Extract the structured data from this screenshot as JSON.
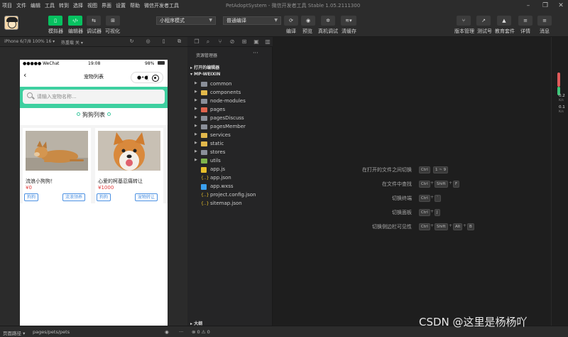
{
  "menu": [
    "项目",
    "文件",
    "编辑",
    "工具",
    "转到",
    "选择",
    "视图",
    "界面",
    "设置",
    "帮助",
    "微信开发者工具"
  ],
  "window_title": "PetAdoptSystem - 微信开发者工具 Stable 1.05.2111300",
  "toolbar": {
    "simulator": "模拟器",
    "editor": "编辑器",
    "debugger": "调试器",
    "visual": "可视化",
    "mode_select": "小程序模式",
    "compile_select": "普通编译",
    "compile": "编译",
    "preview": "预览",
    "real_debug": "真机调试",
    "clear_cache": "清缓存",
    "version": "版本管理",
    "test": "测试号",
    "edu": "教育套件",
    "details": "详情",
    "messages": "消息"
  },
  "simbar": {
    "device": "iPhone 6/7/8 100% 16 ▾",
    "hotreload": "热重载 关 ▾"
  },
  "phone": {
    "carrier": "●●●●● WeChat",
    "time": "19:08",
    "battery": "98%",
    "page_title": "宠物列表",
    "search_placeholder": "请输入宠物名称...",
    "section_title": "狗狗列表",
    "cards": [
      {
        "name": "流浪小狗狗！",
        "price": "¥0",
        "tags": [
          "狗狗",
          "流浪领养"
        ]
      },
      {
        "name": "心爱的柯基忍痛转让",
        "price": "¥1000",
        "tags": [
          "狗狗",
          "宠物转让"
        ]
      }
    ]
  },
  "explorer": {
    "header": "资源管理器",
    "open_editors": "打开的编辑器",
    "project": "MP-WEIXIN",
    "items": [
      "common",
      "components",
      "node-modules",
      "pages",
      "pagesDiscuss",
      "pagesMember",
      "services",
      "static",
      "stores",
      "utils",
      "app.js",
      "app.json",
      "app.wxss",
      "project.config.json",
      "sitemap.json"
    ],
    "outline": "大纲"
  },
  "shortcuts": [
    {
      "label": "在打开的文件之间切换",
      "keys": [
        "Ctrl",
        "1 ~ 9"
      ]
    },
    {
      "label": "在文件中查找",
      "keys": [
        "Ctrl",
        "Shift",
        "F"
      ]
    },
    {
      "label": "切换终端",
      "keys": [
        "Ctrl",
        "`"
      ]
    },
    {
      "label": "切换面板",
      "keys": [
        "Ctrl",
        "J"
      ]
    },
    {
      "label": "切换侧边栏可见性",
      "keys": [
        "Ctrl",
        "Shift",
        "Alt",
        "B"
      ]
    }
  ],
  "rightstrip": {
    "up": "0.2",
    "down": "0.1",
    "unit": "K/s"
  },
  "statusbar": {
    "path_label": "页面路径 ▾",
    "path": "pages/pets/pets",
    "problems": "⊗ 0 ⚠ 0"
  },
  "watermark": "CSDN @这里是杨杨吖"
}
